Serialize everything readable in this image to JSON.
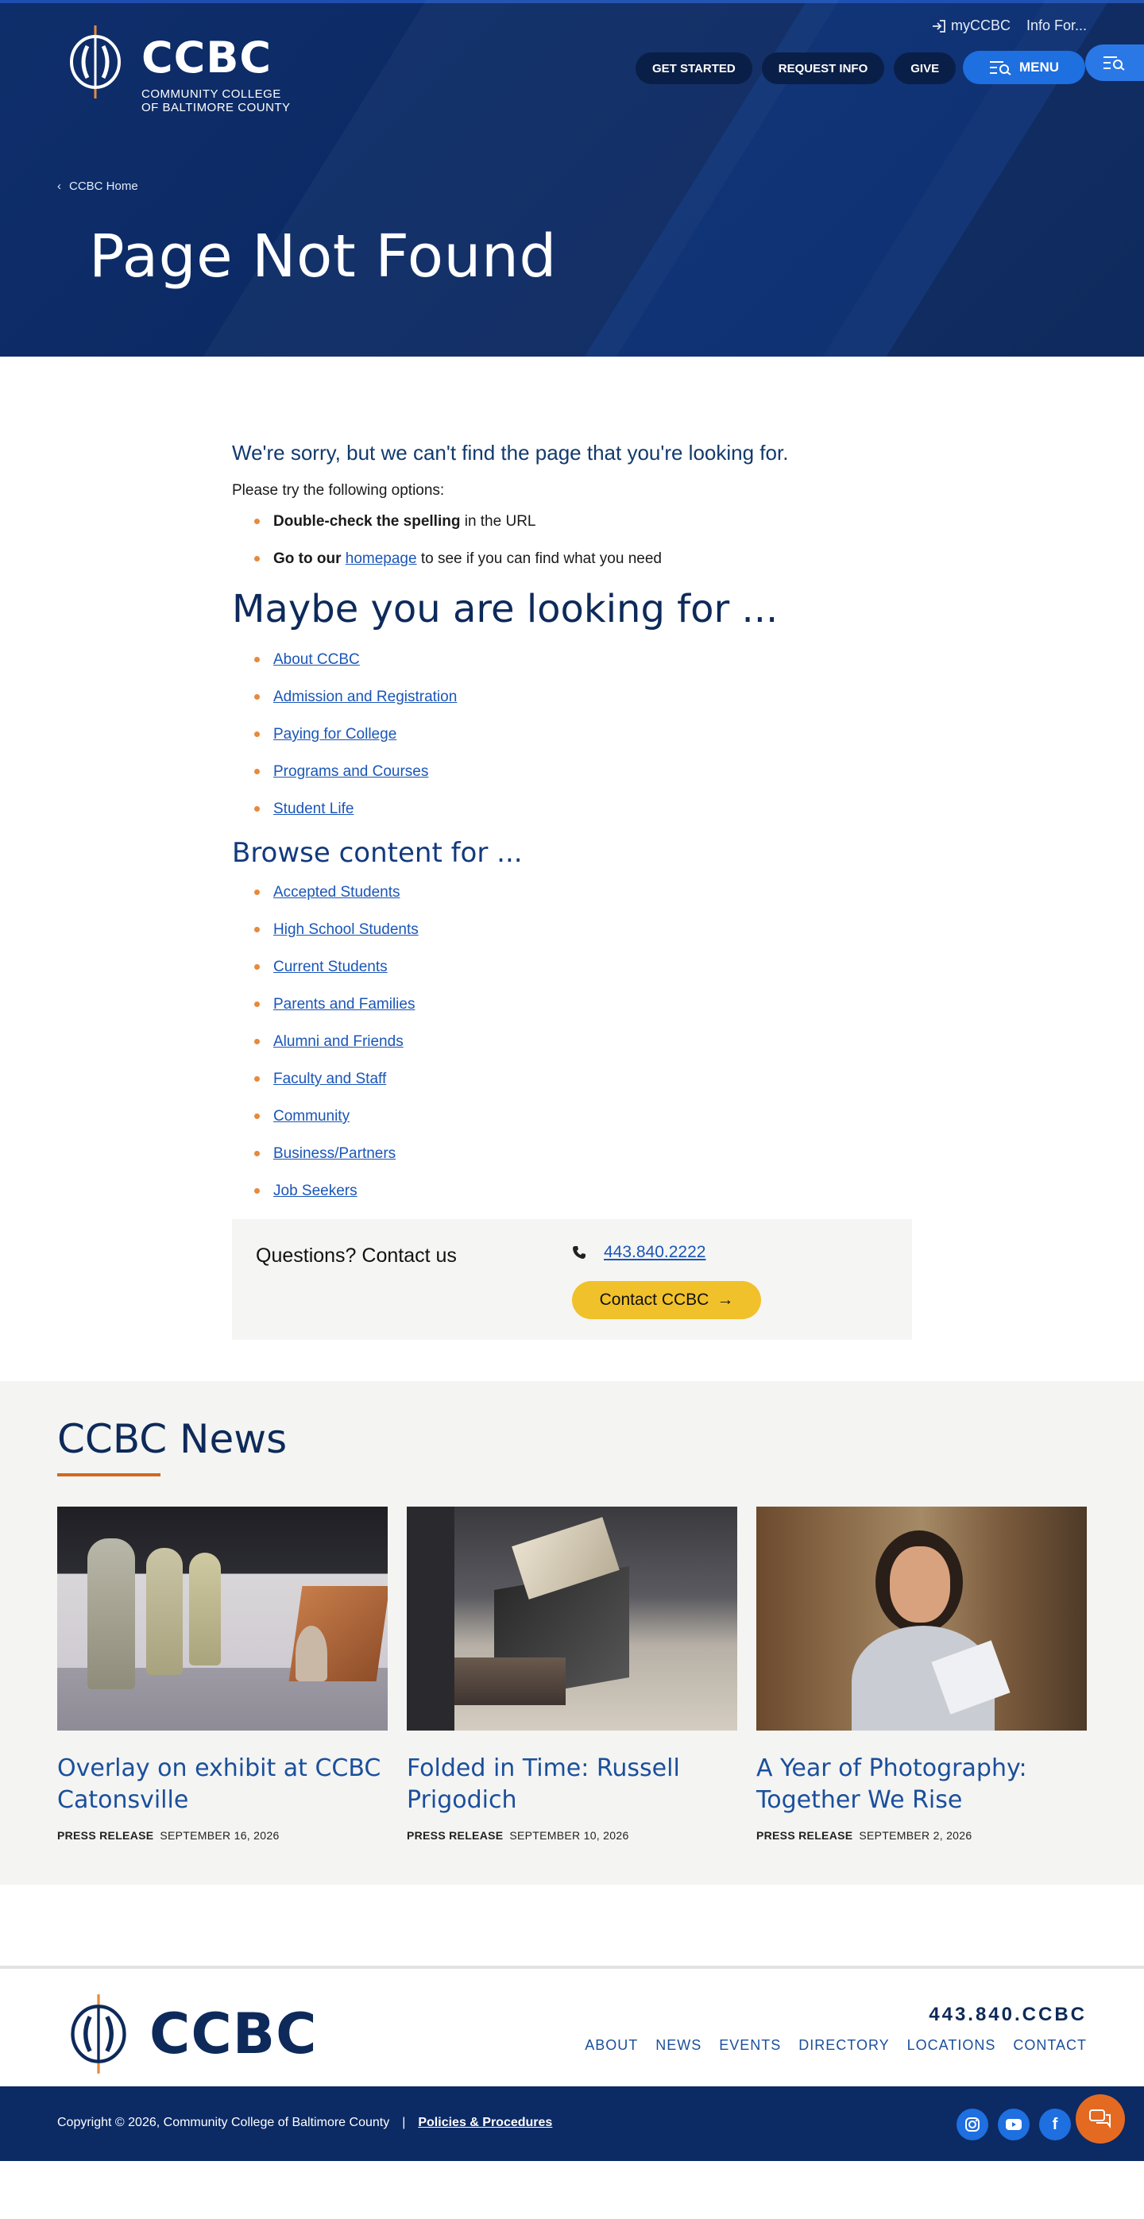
{
  "header": {
    "logo_word": "CCBC",
    "logo_sub_line1": "COMMUNITY COLLEGE",
    "logo_sub_line2": "OF BALTIMORE COUNTY",
    "utility": {
      "my_ccbc": "myCCBC",
      "info_for": "Info For..."
    },
    "buttons": {
      "get_started": "GET STARTED",
      "request_info": "REQUEST INFO",
      "give": "GIVE",
      "menu": "MENU"
    },
    "breadcrumb": "CCBC Home",
    "title": "Page Not Found"
  },
  "main": {
    "lead": "We're sorry, but we can't find the page that you're looking for.",
    "try_options": "Please try the following options:",
    "option1_bold": "Double-check the spelling",
    "option1_rest": " in the URL",
    "option2_bold": "Go to our ",
    "option2_link": "homepage",
    "option2_rest": " to see if you can find what you need",
    "maybe_heading": "Maybe you are looking for ...",
    "maybe_links": [
      "About CCBC",
      "Admission and Registration",
      "Paying for College",
      "Programs and Courses",
      "Student Life"
    ],
    "browse_heading": "Browse content for ...",
    "browse_links": [
      "Accepted Students",
      "High School Students",
      "Current Students",
      "Parents and Families",
      "Alumni and Friends",
      "Faculty and Staff",
      "Community",
      "Business/Partners",
      "Job Seekers"
    ],
    "contact": {
      "title": "Questions? Contact us",
      "phone": "443.840.2222",
      "button": "Contact CCBC"
    }
  },
  "news": {
    "heading": "CCBC News",
    "items": [
      {
        "title": "Overlay on exhibit at CCBC Catonsville",
        "type": "PRESS RELEASE",
        "date": "SEPTEMBER 16, 2026"
      },
      {
        "title": "Folded in Time: Russell Prigodich",
        "type": "PRESS RELEASE",
        "date": "SEPTEMBER 10, 2026"
      },
      {
        "title": "A Year of Photography: Together We Rise",
        "type": "PRESS RELEASE",
        "date": "SEPTEMBER 2, 2026"
      }
    ]
  },
  "footer": {
    "logo_word": "CCBC",
    "phone": "443.840.CCBC",
    "nav": [
      "ABOUT",
      "NEWS",
      "EVENTS",
      "DIRECTORY",
      "LOCATIONS",
      "CONTACT"
    ],
    "copyright": "Copyright © 2026, Community College of Baltimore County",
    "separator": "|",
    "policies": "Policies & Procedures",
    "socials": [
      "instagram-icon",
      "youtube-icon",
      "facebook-icon"
    ]
  },
  "colors": {
    "brand_navy": "#0c2a64",
    "accent_blue": "#1e6fe0",
    "accent_orange": "#e68a3c",
    "button_yellow": "#f0c12a"
  }
}
